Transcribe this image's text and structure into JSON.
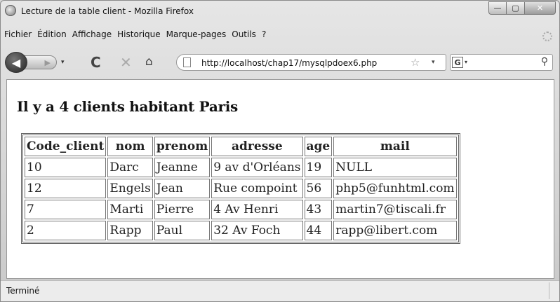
{
  "window": {
    "title": "Lecture de la table client - Mozilla Firefox",
    "controls": {
      "minimize": "—",
      "maximize": "▢",
      "close": "✕"
    }
  },
  "menubar": {
    "items": [
      "Fichier",
      "Édition",
      "Affichage",
      "Historique",
      "Marque-pages",
      "Outils",
      "?"
    ]
  },
  "navbar": {
    "url": "http://localhost/chap17/mysqlpdoex6.php",
    "back_icon": "back-arrow-icon",
    "forward_icon": "forward-arrow-icon",
    "reload_glyph": "C",
    "stop_glyph": "✕",
    "home_glyph": "⌂",
    "star_glyph": "☆",
    "dropdown_glyph": "▾",
    "search_engine_glyph": "G",
    "search_glyph": "⚲",
    "search_placeholder": ""
  },
  "page": {
    "heading": "Il y a 4 clients habitant Paris",
    "table": {
      "headers": [
        "Code_client",
        "nom",
        "prenom",
        "adresse",
        "age",
        "mail"
      ],
      "rows": [
        [
          "10",
          "Darc",
          "Jeanne",
          "9 av d'Orléans",
          "19",
          "NULL"
        ],
        [
          "12",
          "Engels",
          "Jean",
          "Rue compoint",
          "56",
          "php5@funhtml.com"
        ],
        [
          "7",
          "Marti",
          "Pierre",
          "4 Av Henri",
          "43",
          "martin7@tiscali.fr"
        ],
        [
          "2",
          "Rapp",
          "Paul",
          "32 Av Foch",
          "44",
          "rapp@libert.com"
        ]
      ]
    }
  },
  "statusbar": {
    "text": "Terminé"
  }
}
